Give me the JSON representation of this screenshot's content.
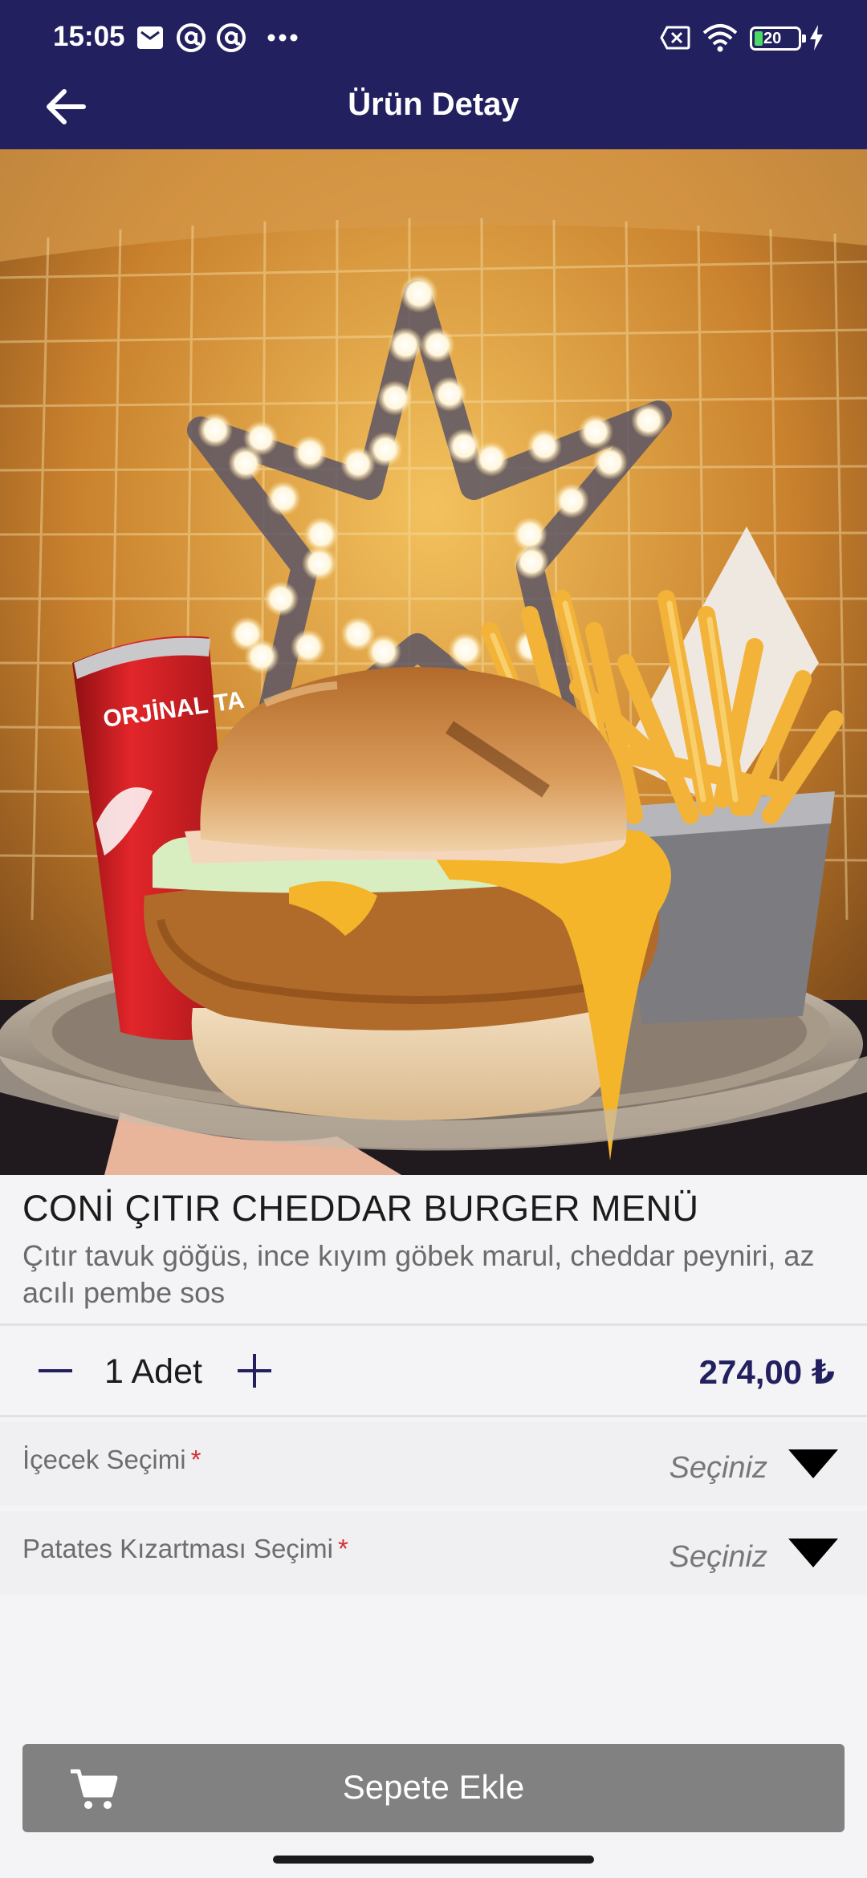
{
  "status_bar": {
    "time": "15:05",
    "battery_level": "20",
    "icons": [
      "mail-icon",
      "at-sign-icon",
      "at-sign-icon",
      "more-dots-icon",
      "sim-off-icon",
      "wifi-icon",
      "battery-icon",
      "charging-icon"
    ]
  },
  "header": {
    "title": "Ürün Detay",
    "back_icon": "arrow-left-icon"
  },
  "hero_image": {
    "subject": "burger-menu-photo",
    "can_text": "ORJİNAL TA"
  },
  "product": {
    "name": "CONİ ÇITIR CHEDDAR BURGER MENÜ",
    "description": "Çıtır tavuk göğüs, ince kıyım göbek marul, cheddar peyniri, az acılı pembe sos"
  },
  "quantity": {
    "value_label": "1 Adet",
    "price": "274,00 ₺"
  },
  "options": [
    {
      "label": "İçecek Seçimi",
      "required_mark": "*",
      "placeholder": "Seçiniz"
    },
    {
      "label": "Patates Kızartması Seçimi",
      "required_mark": "*",
      "placeholder": "Seçiniz"
    }
  ],
  "cart": {
    "label": "Sepete Ekle",
    "icon": "cart-icon"
  },
  "colors": {
    "primary": "#22205f",
    "button_disabled": "#818181",
    "required": "#d32f2f"
  }
}
